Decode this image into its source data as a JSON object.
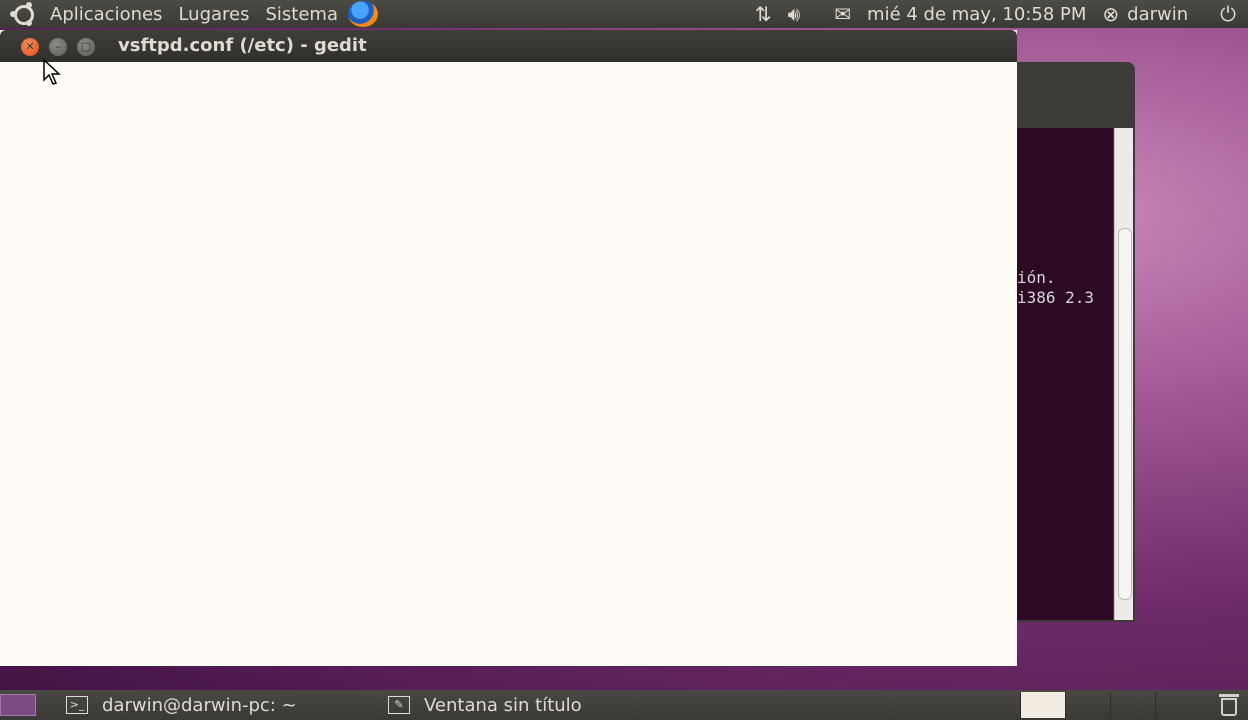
{
  "top_panel": {
    "menu_applications": "Aplicaciones",
    "menu_places": "Lugares",
    "menu_system": "Sistema",
    "datetime": "mié  4 de may, 10:58 PM",
    "user": "darwin"
  },
  "terminal": {
    "line1": "ión.",
    "line2": "i386 2.3"
  },
  "gedit": {
    "title": "vsftpd.conf (/etc) - gedit"
  },
  "bottom_panel": {
    "task1": "darwin@darwin-pc: ~",
    "task2": "Ventana sin título"
  },
  "colors": {
    "terminal_bg": "#2c0a24",
    "close_button": "#df4b16",
    "panel": "#3a3935"
  }
}
